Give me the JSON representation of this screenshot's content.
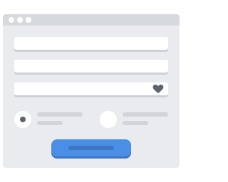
{
  "icons": {
    "window_controls": [
      "dot",
      "dot",
      "dot"
    ],
    "favorite_field_icon": "heart-icon"
  },
  "colors": {
    "window_background": "#e9ebee",
    "titlebar": "#d6d9de",
    "field": "#ffffff",
    "accent": "#4b8ee6",
    "icon": "#5d6470"
  },
  "form": {
    "radio_options": [
      {
        "selected": true
      },
      {
        "selected": false
      }
    ]
  }
}
